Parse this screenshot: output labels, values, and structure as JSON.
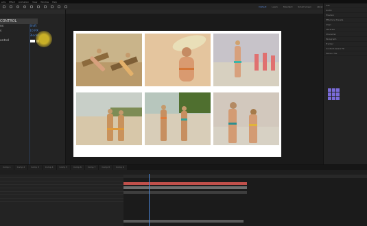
{
  "menu": [
    "ects",
    "Effect",
    "Animation",
    "View",
    "Window",
    "Help"
  ],
  "workspace": [
    "Default",
    "Learn",
    "Standard",
    "Small Screen",
    "Libraries"
  ],
  "effects": {
    "header": "CONTROL",
    "rows": [
      {
        "label": "ns",
        "value": "Shift"
      },
      {
        "label": "s",
        "value": "10 PX"
      },
      {
        "label": "",
        "value": "Blocks"
      },
      {
        "label": "ontrol",
        "value": ""
      }
    ]
  },
  "right_panel": [
    "Info",
    "Audio",
    "Preview",
    "Effects & Presets",
    "Align",
    "Libraries",
    "Character",
    "Paragraph",
    "Tracker",
    "Content-Aware Fill",
    "Motion Tile"
  ],
  "timeline_tabs": [
    "Comp 1",
    "Comp 2",
    "Comp 3",
    "Comp 4",
    "Comp 5",
    "Comp 6",
    "Comp 7",
    "Comp 8",
    "Comp 9"
  ]
}
